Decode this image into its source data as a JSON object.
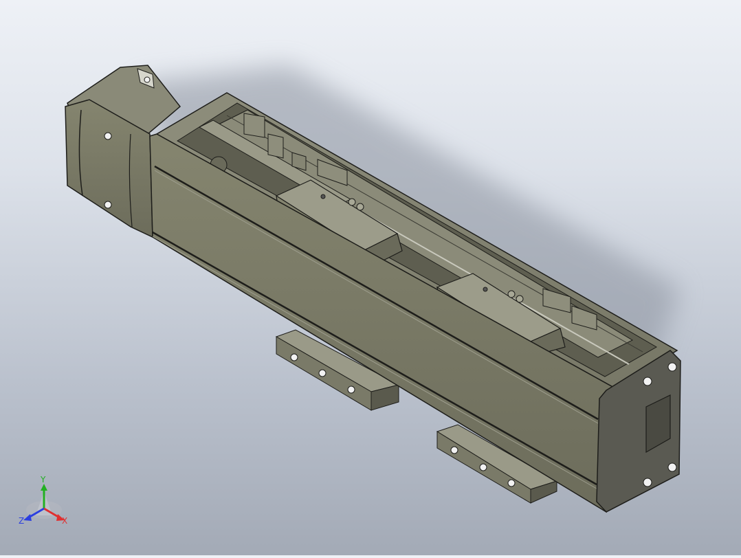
{
  "viewport": {
    "colors": {
      "background_top": "#eef1f6",
      "background_bottom": "#a3aab6",
      "body_main": "#767664",
      "body_light": "#8c8c7a",
      "body_dark": "#4f4f45",
      "edge": "#1d1d1a"
    }
  },
  "triad": {
    "x_label": "X",
    "y_label": "Y",
    "z_label": "Z",
    "x_color": "#e03030",
    "y_color": "#22b022",
    "z_color": "#2b3fe0"
  }
}
